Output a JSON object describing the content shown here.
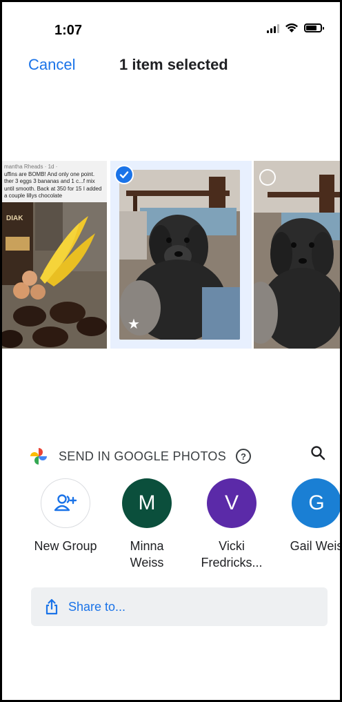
{
  "status_bar": {
    "time": "1:07",
    "icons": [
      "signal-icon",
      "wifi-icon",
      "battery-icon"
    ]
  },
  "header": {
    "cancel_label": "Cancel",
    "title": "1 item selected"
  },
  "photos": [
    {
      "caption_author": "mantha Rheads · 1d · ",
      "caption_text": "uffins are BOMB! And only one point. ther 3 eggs 3 bananas and 1 c...f mix until smooth. Back at 350 for 15 I added a couple lillys chocolate",
      "brand_text": "DIAK",
      "selected": false
    },
    {
      "selected": true,
      "favorite": true
    },
    {
      "selected": false
    }
  ],
  "send": {
    "label": "SEND IN GOOGLE PHOTOS",
    "help_icon": "help-icon",
    "search_icon": "search-icon"
  },
  "contacts": [
    {
      "name_line1": "New Group",
      "name_line2": "",
      "icon": "add-group-icon"
    },
    {
      "initial": "M",
      "name_line1": "Minna",
      "name_line2": "Weiss",
      "color": "#0b4f3c"
    },
    {
      "initial": "V",
      "name_line1": "Vicki",
      "name_line2": "Fredricks...",
      "color": "#5b2aa8"
    },
    {
      "initial": "G",
      "name_line1": "Gail Weis",
      "name_line2": "",
      "color": "#1a7fd4"
    }
  ],
  "share": {
    "label": "Share to...",
    "icon": "share-icon"
  },
  "colors": {
    "accent": "#1a73e8",
    "selected_bg": "#e8f0fe"
  }
}
